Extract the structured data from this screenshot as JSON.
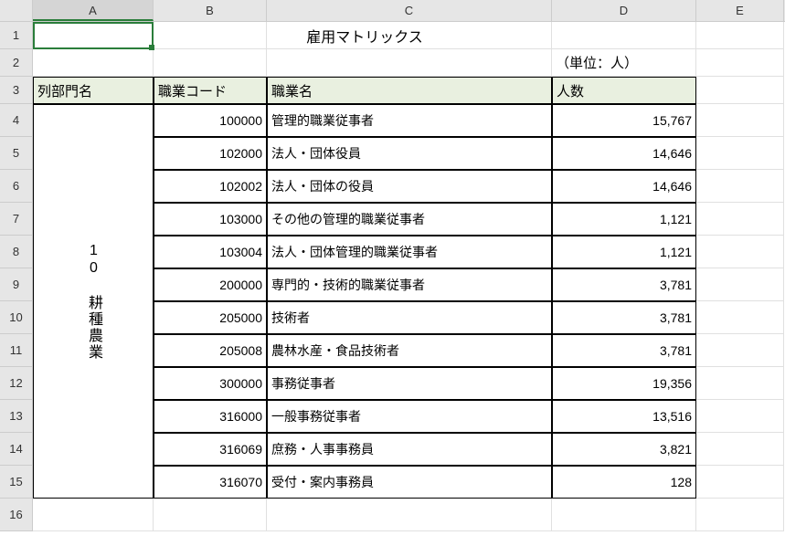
{
  "columns": [
    "A",
    "B",
    "C",
    "D",
    "E"
  ],
  "title": "雇用マトリックス",
  "unit_label": "（単位：人）",
  "headers": {
    "colA": "列部門名",
    "colB": "職業コード",
    "colC": "職業名",
    "colD": "人数"
  },
  "sector_label": "10 耕種農業",
  "rows": [
    {
      "code": "100000",
      "name": "管理的職業従事者",
      "count": "15,767"
    },
    {
      "code": "102000",
      "name": "法人・団体役員",
      "count": "14,646"
    },
    {
      "code": "102002",
      "name": "法人・団体の役員",
      "count": "14,646"
    },
    {
      "code": "103000",
      "name": "その他の管理的職業従事者",
      "count": "1,121"
    },
    {
      "code": "103004",
      "name": "法人・団体管理的職業従事者",
      "count": "1,121"
    },
    {
      "code": "200000",
      "name": "専門的・技術的職業従事者",
      "count": "3,781"
    },
    {
      "code": "205000",
      "name": "技術者",
      "count": "3,781"
    },
    {
      "code": "205008",
      "name": "農林水産・食品技術者",
      "count": "3,781"
    },
    {
      "code": "300000",
      "name": "事務従事者",
      "count": "19,356"
    },
    {
      "code": "316000",
      "name": "一般事務従事者",
      "count": "13,516"
    },
    {
      "code": "316069",
      "name": "庶務・人事事務員",
      "count": "3,821"
    },
    {
      "code": "316070",
      "name": "受付・案内事務員",
      "count": "128"
    }
  ],
  "chart_data": {
    "type": "table",
    "title": "雇用マトリックス",
    "unit": "人",
    "sector": "10 耕種農業",
    "columns": [
      "職業コード",
      "職業名",
      "人数"
    ],
    "data": [
      [
        100000,
        "管理的職業従事者",
        15767
      ],
      [
        102000,
        "法人・団体役員",
        14646
      ],
      [
        102002,
        "法人・団体の役員",
        14646
      ],
      [
        103000,
        "その他の管理的職業従事者",
        1121
      ],
      [
        103004,
        "法人・団体管理的職業従事者",
        1121
      ],
      [
        200000,
        "専門的・技術的職業従事者",
        3781
      ],
      [
        205000,
        "技術者",
        3781
      ],
      [
        205008,
        "農林水産・食品技術者",
        3781
      ],
      [
        300000,
        "事務従事者",
        19356
      ],
      [
        316000,
        "一般事務従事者",
        13516
      ],
      [
        316069,
        "庶務・人事事務員",
        3821
      ],
      [
        316070,
        "受付・案内事務員",
        128
      ]
    ]
  }
}
